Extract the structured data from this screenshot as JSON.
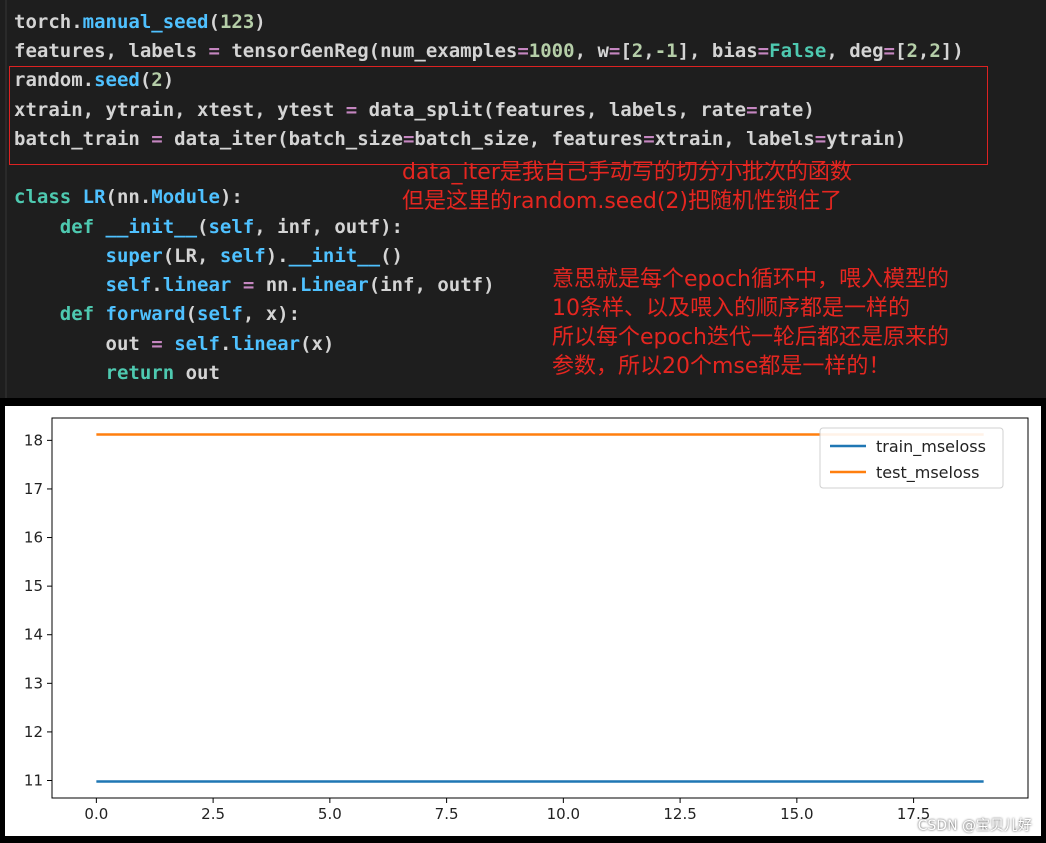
{
  "code": {
    "line1": {
      "a": "torch.",
      "b": "manual_seed",
      "c": "(",
      "d": "123",
      "e": ")"
    },
    "line2": {
      "a": "features, labels ",
      "b": "=",
      "c": " tensorGenReg(num_examples",
      "d": "=",
      "e": "1000",
      "f": ", w",
      "g": "=",
      "h": "[",
      "i": "2",
      ",": ",",
      "j": "-1",
      "k": "], bias",
      "l": "=",
      "m": "False",
      "n": ", deg",
      "o": "=",
      "p": "[",
      "q": "2",
      "r": ",",
      "s": "2",
      "t": "])"
    },
    "line3": {
      "a": "random.",
      "b": "seed",
      "c": "(",
      "d": "2",
      "e": ")"
    },
    "line4": {
      "a": "xtrain, ytrain, xtest, ytest ",
      "b": "=",
      "c": " data_split(features, labels, rate",
      "d": "=",
      "e": "rate)"
    },
    "line5": {
      "a": "batch_train ",
      "b": "=",
      "c": " data_iter(batch_size",
      "d": "=",
      "e": "batch_size, features",
      "f": "=",
      "g": "xtrain, labels",
      "h": "=",
      "i": "ytrain)"
    },
    "line6": {
      "a": "class ",
      "b": "LR",
      "c": "(nn.",
      "d": "Module",
      "e": "):"
    },
    "line7": {
      "a": "    def ",
      "b": "__init__",
      "c": "(",
      "d": "self",
      ",": ", inf, outf):"
    },
    "line8": {
      "a": "        ",
      "b": "super",
      "c": "(LR, ",
      "d": "self",
      "e": ").",
      "f": "__init__",
      "g": "()"
    },
    "line9": {
      "a": "        ",
      "b": "self",
      "c": ".",
      "d": "linear",
      "e": " ",
      "f": "=",
      "g": " nn.",
      "h": "Linear",
      "i": "(inf, outf)"
    },
    "line10": {
      "a": "    def ",
      "b": "forward",
      "c": "(",
      "d": "self",
      "e": ", x):"
    },
    "line11": {
      "a": "        out ",
      "b": "=",
      "c": " ",
      "d": "self",
      "e": ".",
      "f": "linear",
      "g": "(x)"
    },
    "line12": {
      "a": "        ",
      "b": "return",
      "c": " out"
    }
  },
  "annotations": {
    "note1_line1": "data_iter是我自己手动写的切分小批次的函数",
    "note1_line2": "但是这里的random.seed(2)把随机性锁住了",
    "note2_line1": "意思就是每个epoch循环中，喂入模型的",
    "note2_line2": "10条样、以及喂入的顺序都是一样的",
    "note2_line3": "所以每个epoch迭代一轮后都还是原来的",
    "note2_line4": "参数，所以20个mse都是一样的！"
  },
  "chart_data": {
    "type": "line",
    "x": [
      0,
      1,
      2,
      3,
      4,
      5,
      6,
      7,
      8,
      9,
      10,
      11,
      12,
      13,
      14,
      15,
      16,
      17,
      18,
      19
    ],
    "series": [
      {
        "name": "train_mseloss",
        "values": [
          10.98,
          10.98,
          10.98,
          10.98,
          10.98,
          10.98,
          10.98,
          10.98,
          10.98,
          10.98,
          10.98,
          10.98,
          10.98,
          10.98,
          10.98,
          10.98,
          10.98,
          10.98,
          10.98,
          10.98
        ],
        "color": "#1f77b4"
      },
      {
        "name": "test_mseloss",
        "values": [
          18.12,
          18.12,
          18.12,
          18.12,
          18.12,
          18.12,
          18.12,
          18.12,
          18.12,
          18.12,
          18.12,
          18.12,
          18.12,
          18.12,
          18.12,
          18.12,
          18.12,
          18.12,
          18.12,
          18.12
        ],
        "color": "#ff7f0e"
      }
    ],
    "xticks": [
      "0.0",
      "2.5",
      "5.0",
      "7.5",
      "10.0",
      "12.5",
      "15.0",
      "17.5"
    ],
    "xtick_values": [
      0,
      2.5,
      5,
      7.5,
      10,
      12.5,
      15,
      17.5
    ],
    "yticks": [
      "11",
      "12",
      "13",
      "14",
      "15",
      "16",
      "17",
      "18"
    ],
    "ytick_values": [
      11,
      12,
      13,
      14,
      15,
      16,
      17,
      18
    ],
    "xlim": [
      -0.95,
      19.95
    ],
    "ylim": [
      10.64,
      18.46
    ],
    "legend_position": "top-right",
    "grid": false
  },
  "watermark": "CSDN @宝贝儿好"
}
